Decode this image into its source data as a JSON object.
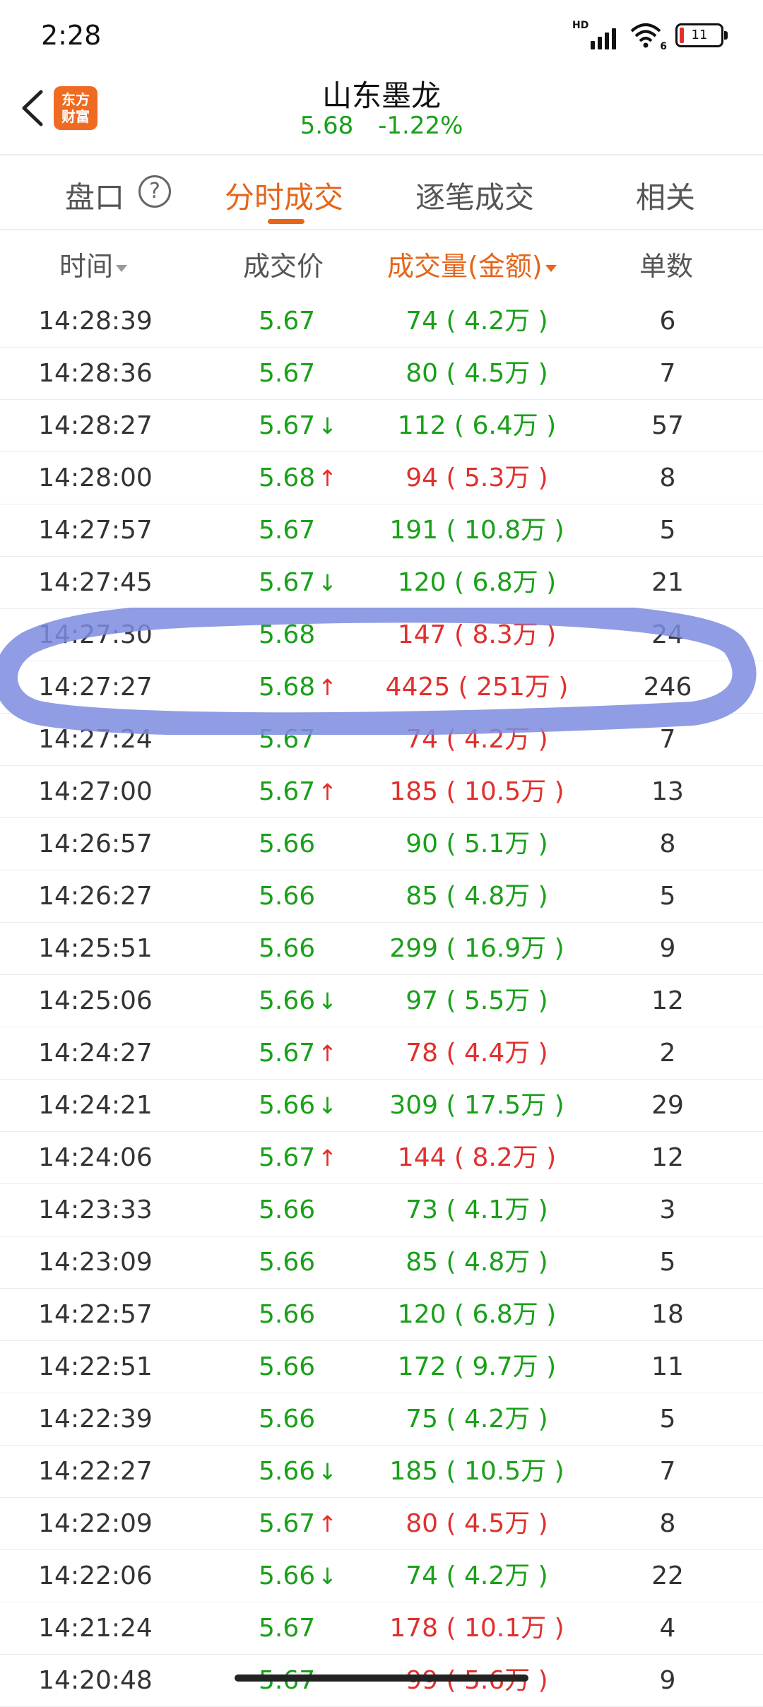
{
  "status_bar": {
    "time": "2:28",
    "signal_label": "HD",
    "wifi_label": "6",
    "battery": "11"
  },
  "header": {
    "back_icon": "chevron-left-icon",
    "logo_text_1": "东方",
    "logo_text_2": "财富",
    "stock_name": "山东墨龙",
    "price": "5.68",
    "change": "-1.22%",
    "change_color": "#19a019"
  },
  "tabs": [
    {
      "label": "盘口",
      "active": false
    },
    {
      "label": "分时成交",
      "active": true
    },
    {
      "label": "逐笔成交",
      "active": false
    },
    {
      "label": "相关",
      "active": false
    }
  ],
  "help_icon": "?",
  "columns": {
    "time": "时间",
    "price": "成交价",
    "volume": "成交量(金额)",
    "count": "单数"
  },
  "colors": {
    "accent": "#e5661b",
    "up": "#e0302d",
    "down": "#19a019",
    "highlight": "#7d8ce0"
  },
  "rows": [
    {
      "time": "14:28:39",
      "price": "5.67",
      "dir": "",
      "volume": "74 ( 4.2万 )",
      "vol_color": "g",
      "count": "6"
    },
    {
      "time": "14:28:36",
      "price": "5.67",
      "dir": "",
      "volume": "80 ( 4.5万 )",
      "vol_color": "g",
      "count": "7"
    },
    {
      "time": "14:28:27",
      "price": "5.67",
      "dir": "down",
      "volume": "112 ( 6.4万 )",
      "vol_color": "g",
      "count": "57"
    },
    {
      "time": "14:28:00",
      "price": "5.68",
      "dir": "up",
      "volume": "94 ( 5.3万 )",
      "vol_color": "r",
      "count": "8"
    },
    {
      "time": "14:27:57",
      "price": "5.67",
      "dir": "",
      "volume": "191 ( 10.8万 )",
      "vol_color": "g",
      "count": "5"
    },
    {
      "time": "14:27:45",
      "price": "5.67",
      "dir": "down",
      "volume": "120 ( 6.8万 )",
      "vol_color": "g",
      "count": "21"
    },
    {
      "time": "14:27:30",
      "price": "5.68",
      "dir": "",
      "volume": "147 ( 8.3万 )",
      "vol_color": "r",
      "count": "24"
    },
    {
      "time": "14:27:27",
      "price": "5.68",
      "dir": "up",
      "volume": "4425 ( 251万 )",
      "vol_color": "r",
      "count": "246"
    },
    {
      "time": "14:27:24",
      "price": "5.67",
      "dir": "",
      "volume": "74 ( 4.2万 )",
      "vol_color": "r",
      "count": "7"
    },
    {
      "time": "14:27:00",
      "price": "5.67",
      "dir": "up",
      "volume": "185 ( 10.5万 )",
      "vol_color": "r",
      "count": "13"
    },
    {
      "time": "14:26:57",
      "price": "5.66",
      "dir": "",
      "volume": "90 ( 5.1万 )",
      "vol_color": "g",
      "count": "8"
    },
    {
      "time": "14:26:27",
      "price": "5.66",
      "dir": "",
      "volume": "85 ( 4.8万 )",
      "vol_color": "g",
      "count": "5"
    },
    {
      "time": "14:25:51",
      "price": "5.66",
      "dir": "",
      "volume": "299 ( 16.9万 )",
      "vol_color": "g",
      "count": "9"
    },
    {
      "time": "14:25:06",
      "price": "5.66",
      "dir": "down",
      "volume": "97 ( 5.5万 )",
      "vol_color": "g",
      "count": "12"
    },
    {
      "time": "14:24:27",
      "price": "5.67",
      "dir": "up",
      "volume": "78 ( 4.4万 )",
      "vol_color": "r",
      "count": "2"
    },
    {
      "time": "14:24:21",
      "price": "5.66",
      "dir": "down",
      "volume": "309 ( 17.5万 )",
      "vol_color": "g",
      "count": "29"
    },
    {
      "time": "14:24:06",
      "price": "5.67",
      "dir": "up",
      "volume": "144 ( 8.2万 )",
      "vol_color": "r",
      "count": "12"
    },
    {
      "time": "14:23:33",
      "price": "5.66",
      "dir": "",
      "volume": "73 ( 4.1万 )",
      "vol_color": "g",
      "count": "3"
    },
    {
      "time": "14:23:09",
      "price": "5.66",
      "dir": "",
      "volume": "85 ( 4.8万 )",
      "vol_color": "g",
      "count": "5"
    },
    {
      "time": "14:22:57",
      "price": "5.66",
      "dir": "",
      "volume": "120 ( 6.8万 )",
      "vol_color": "g",
      "count": "18"
    },
    {
      "time": "14:22:51",
      "price": "5.66",
      "dir": "",
      "volume": "172 ( 9.7万 )",
      "vol_color": "g",
      "count": "11"
    },
    {
      "time": "14:22:39",
      "price": "5.66",
      "dir": "",
      "volume": "75 ( 4.2万 )",
      "vol_color": "g",
      "count": "5"
    },
    {
      "time": "14:22:27",
      "price": "5.66",
      "dir": "down",
      "volume": "185 ( 10.5万 )",
      "vol_color": "g",
      "count": "7"
    },
    {
      "time": "14:22:09",
      "price": "5.67",
      "dir": "up",
      "volume": "80 ( 4.5万 )",
      "vol_color": "r",
      "count": "8"
    },
    {
      "time": "14:22:06",
      "price": "5.66",
      "dir": "down",
      "volume": "74 ( 4.2万 )",
      "vol_color": "g",
      "count": "22"
    },
    {
      "time": "14:21:24",
      "price": "5.67",
      "dir": "",
      "volume": "178 ( 10.1万 )",
      "vol_color": "r",
      "count": "4"
    },
    {
      "time": "14:20:48",
      "price": "5.67",
      "dir": "",
      "volume": "99 ( 5.6万 )",
      "vol_color": "r",
      "count": "9"
    }
  ]
}
